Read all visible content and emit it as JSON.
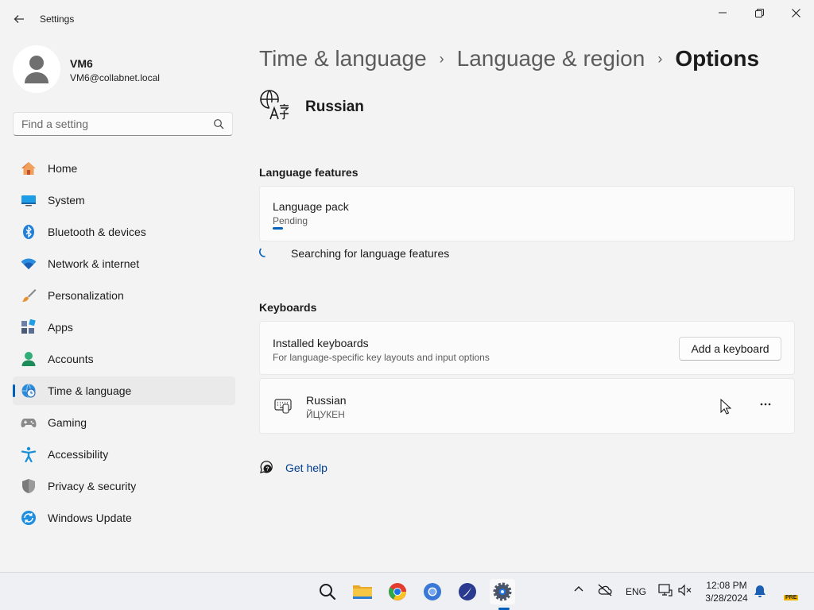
{
  "window": {
    "title": "Settings"
  },
  "profile": {
    "name": "VM6",
    "email": "VM6@collabnet.local"
  },
  "search": {
    "placeholder": "Find a setting"
  },
  "nav": [
    {
      "label": "Home",
      "icon": "home-icon",
      "active": false
    },
    {
      "label": "System",
      "icon": "system-icon",
      "active": false
    },
    {
      "label": "Bluetooth & devices",
      "icon": "bluetooth-icon",
      "active": false
    },
    {
      "label": "Network & internet",
      "icon": "wifi-icon",
      "active": false
    },
    {
      "label": "Personalization",
      "icon": "brush-icon",
      "active": false
    },
    {
      "label": "Apps",
      "icon": "apps-icon",
      "active": false
    },
    {
      "label": "Accounts",
      "icon": "accounts-icon",
      "active": false
    },
    {
      "label": "Time & language",
      "icon": "time-language-icon",
      "active": true
    },
    {
      "label": "Gaming",
      "icon": "gaming-icon",
      "active": false
    },
    {
      "label": "Accessibility",
      "icon": "accessibility-icon",
      "active": false
    },
    {
      "label": "Privacy & security",
      "icon": "shield-icon",
      "active": false
    },
    {
      "label": "Windows Update",
      "icon": "update-icon",
      "active": false
    }
  ],
  "breadcrumb": {
    "level1": "Time & language",
    "level2": "Language & region",
    "current": "Options"
  },
  "language": {
    "name": "Russian"
  },
  "language_features": {
    "section_title": "Language features",
    "pack_title": "Language pack",
    "pack_status": "Pending",
    "pack_progress": 0.02,
    "searching_text": "Searching for language features"
  },
  "keyboards": {
    "section_title": "Keyboards",
    "installed_title": "Installed keyboards",
    "installed_desc": "For language-specific key layouts and input options",
    "add_button": "Add a keyboard",
    "items": [
      {
        "name": "Russian",
        "layout": "ЙЦУКЕН"
      }
    ]
  },
  "help": {
    "label": "Get help"
  },
  "taskbar": {
    "apps": [
      "search-icon",
      "file-explorer-icon",
      "chrome-icon",
      "chrome-canary-icon",
      "feather-app-icon",
      "settings-icon"
    ],
    "language": "ENG",
    "time": "12:08 PM",
    "date": "3/28/2024",
    "badge": "PRE"
  },
  "colors": {
    "accent": "#005fb8",
    "link": "#003e92"
  }
}
